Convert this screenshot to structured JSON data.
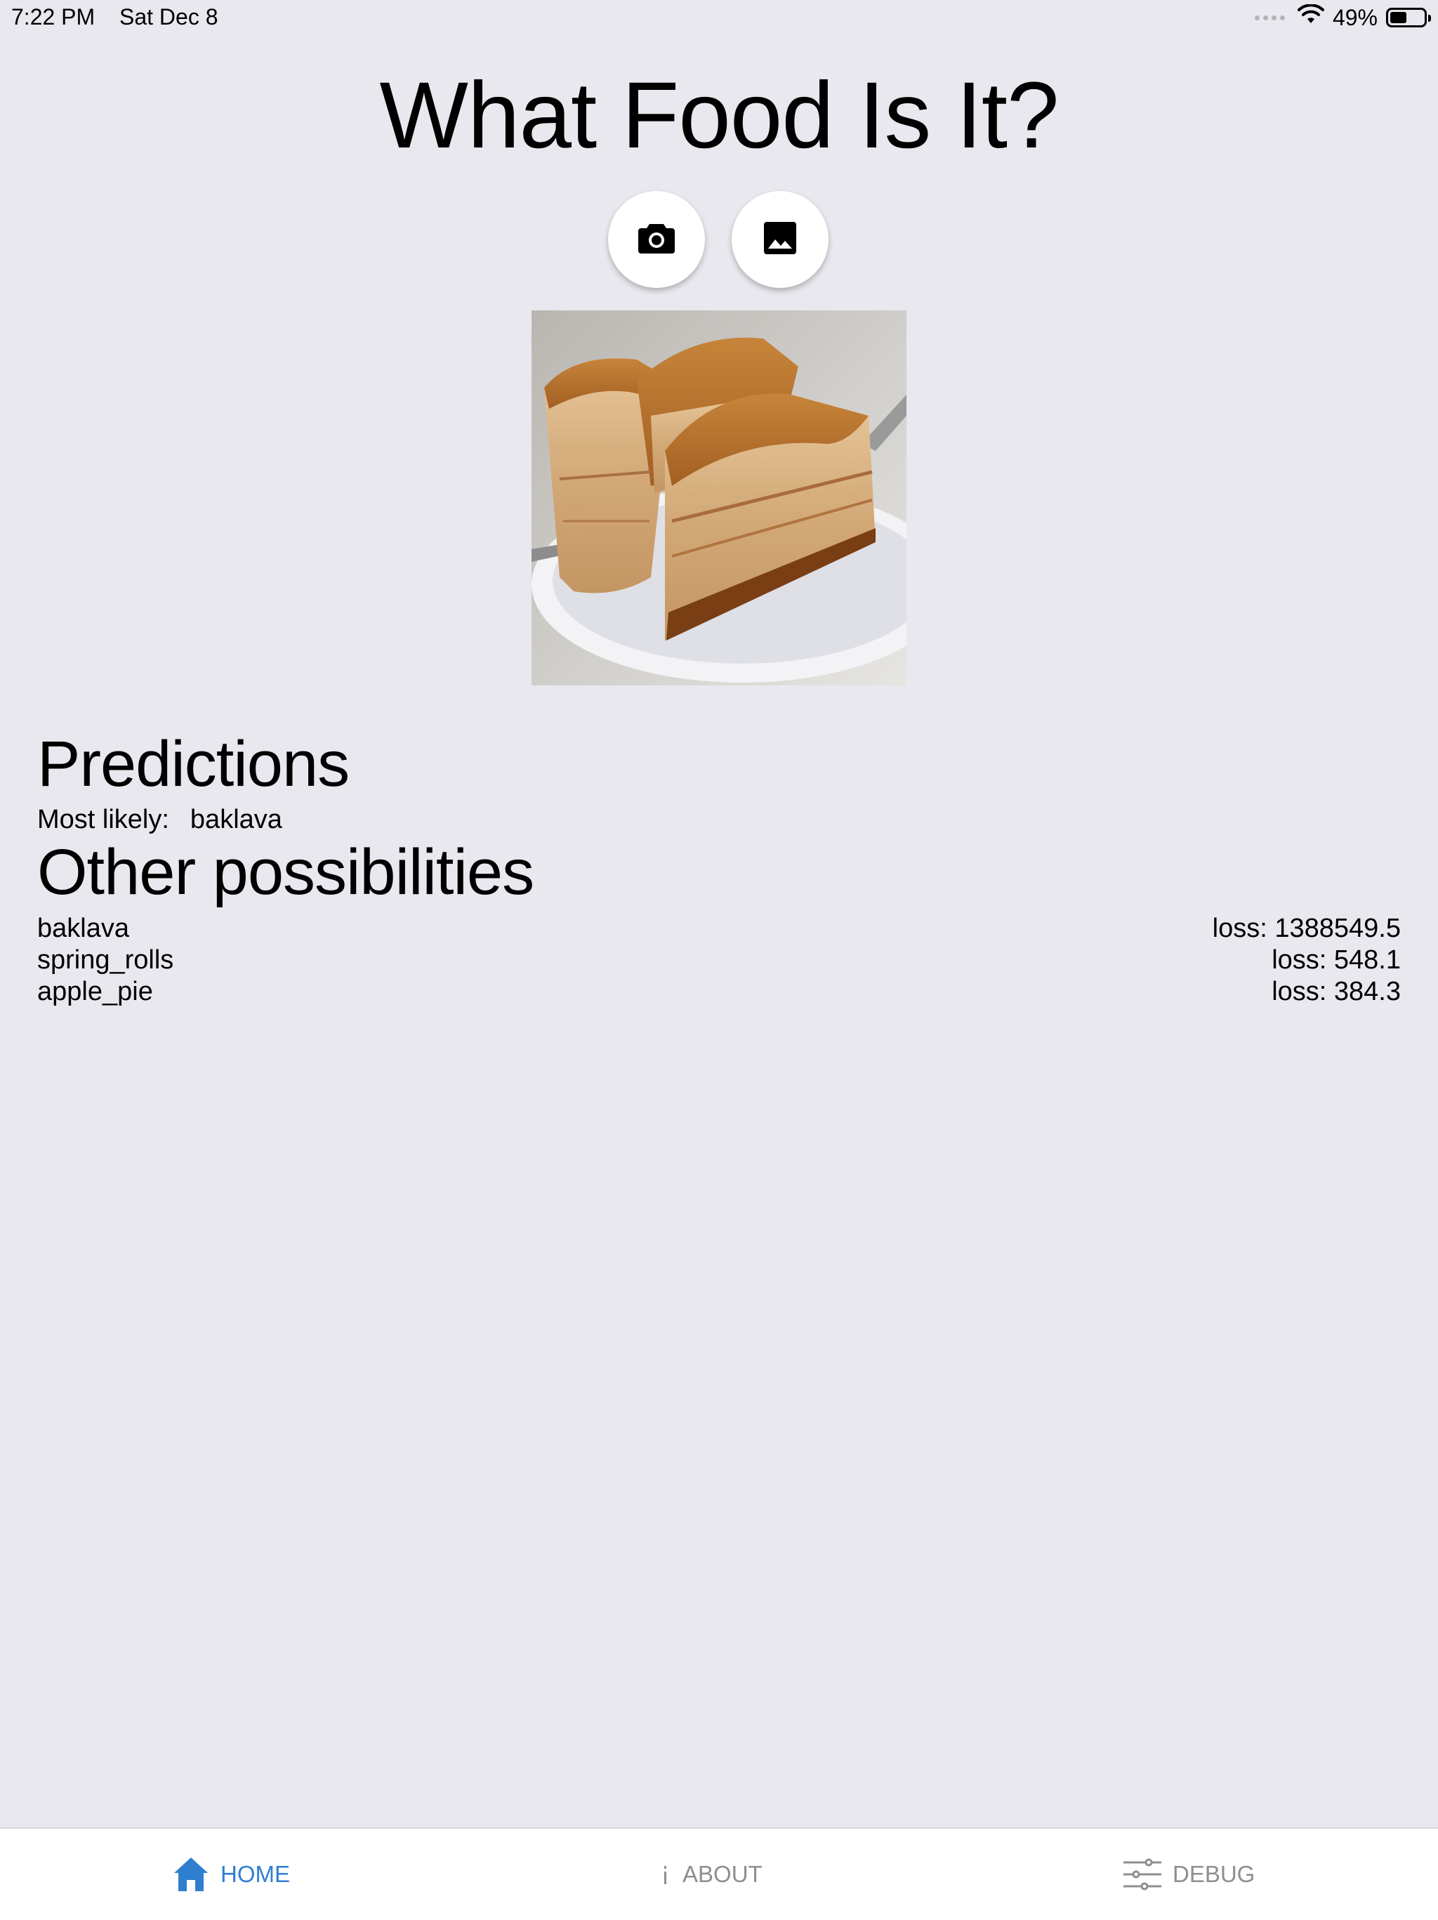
{
  "status_bar": {
    "time": "7:22 PM",
    "date": "Sat Dec 8",
    "battery_percent": "49%",
    "battery_level": 0.49,
    "icons": [
      "cellular-dots-icon",
      "wifi-icon",
      "battery-icon"
    ]
  },
  "header": {
    "title": "What Food Is It?"
  },
  "actions": {
    "camera_icon": "camera-icon",
    "gallery_icon": "image-gallery-icon"
  },
  "photo": {
    "subject": "baklava-photo"
  },
  "predictions": {
    "heading": "Predictions",
    "most_likely_label": "Most likely:",
    "most_likely_value": "baklava",
    "other_heading": "Other possibilities",
    "others": [
      {
        "name": "baklava",
        "loss": "loss: 1388549.5"
      },
      {
        "name": "spring_rolls",
        "loss": "loss: 548.1"
      },
      {
        "name": "apple_pie",
        "loss": "loss: 384.3"
      }
    ]
  },
  "tab_bar": {
    "tabs": [
      {
        "label": "HOME",
        "icon": "home-icon",
        "active": true
      },
      {
        "label": "ABOUT",
        "icon": "info-icon",
        "active": false
      },
      {
        "label": "DEBUG",
        "icon": "sliders-icon",
        "active": false
      }
    ],
    "active_color": "#2f7fd0",
    "inactive_color": "#8e8e93"
  }
}
